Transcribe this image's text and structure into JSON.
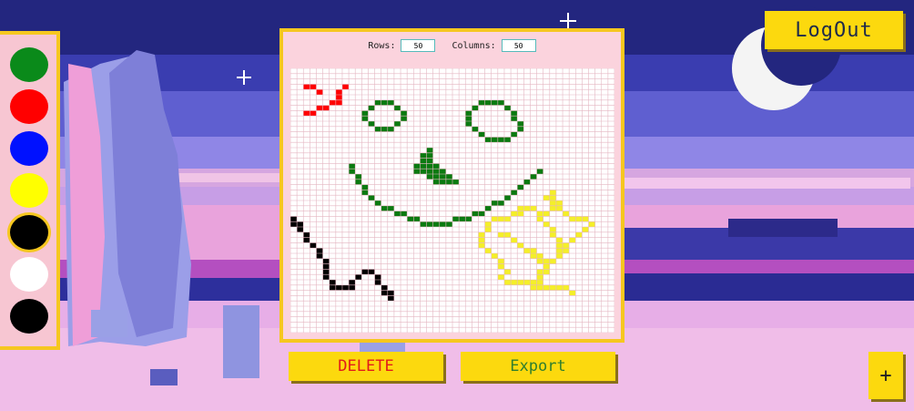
{
  "colors": {
    "palette": [
      "#0a8a1a",
      "#ff0000",
      "#0011ff",
      "#ffff00",
      "#000000",
      "#ffffff",
      "#000000"
    ],
    "accent": "#fcd90e",
    "board_bg": "#fbd3dd",
    "grid_line": "#e4b6c2"
  },
  "selected_color_index": 4,
  "grid": {
    "rows_label": "Rows:",
    "rows_value": "50",
    "columns_label": "Columns:",
    "columns_value": "50",
    "rows": 50,
    "columns": 50
  },
  "drawing": {
    "red": [
      [
        3,
        2
      ],
      [
        3,
        3
      ],
      [
        4,
        4
      ],
      [
        3,
        8
      ],
      [
        4,
        7
      ],
      [
        5,
        7
      ],
      [
        6,
        7
      ],
      [
        6,
        6
      ],
      [
        7,
        5
      ],
      [
        7,
        4
      ],
      [
        8,
        3
      ],
      [
        8,
        2
      ]
    ],
    "green_left_eye": [
      [
        6,
        13
      ],
      [
        6,
        14
      ],
      [
        6,
        15
      ],
      [
        7,
        12
      ],
      [
        7,
        16
      ],
      [
        8,
        11
      ],
      [
        8,
        17
      ],
      [
        9,
        11
      ],
      [
        9,
        17
      ],
      [
        10,
        12
      ],
      [
        10,
        16
      ],
      [
        11,
        13
      ],
      [
        11,
        14
      ],
      [
        11,
        15
      ]
    ],
    "green_right_eye": [
      [
        6,
        29
      ],
      [
        6,
        30
      ],
      [
        6,
        31
      ],
      [
        6,
        32
      ],
      [
        7,
        28
      ],
      [
        7,
        33
      ],
      [
        8,
        27
      ],
      [
        8,
        34
      ],
      [
        9,
        27
      ],
      [
        9,
        34
      ],
      [
        10,
        27
      ],
      [
        10,
        35
      ],
      [
        11,
        28
      ],
      [
        11,
        35
      ],
      [
        12,
        29
      ],
      [
        12,
        34
      ],
      [
        13,
        30
      ],
      [
        13,
        31
      ],
      [
        13,
        32
      ],
      [
        13,
        33
      ]
    ],
    "green_nose": [
      [
        15,
        21
      ],
      [
        16,
        20
      ],
      [
        16,
        21
      ],
      [
        17,
        20
      ],
      [
        17,
        21
      ],
      [
        18,
        19
      ],
      [
        18,
        20
      ],
      [
        18,
        21
      ],
      [
        18,
        22
      ],
      [
        19,
        19
      ],
      [
        19,
        20
      ],
      [
        19,
        21
      ],
      [
        19,
        22
      ],
      [
        19,
        23
      ],
      [
        20,
        21
      ],
      [
        20,
        22
      ],
      [
        20,
        23
      ],
      [
        20,
        24
      ],
      [
        21,
        22
      ],
      [
        21,
        23
      ],
      [
        21,
        24
      ],
      [
        21,
        25
      ]
    ],
    "green_smile": [
      [
        18,
        9
      ],
      [
        19,
        9
      ],
      [
        20,
        10
      ],
      [
        21,
        10
      ],
      [
        22,
        11
      ],
      [
        23,
        11
      ],
      [
        24,
        12
      ],
      [
        25,
        13
      ],
      [
        26,
        14
      ],
      [
        26,
        15
      ],
      [
        27,
        16
      ],
      [
        27,
        17
      ],
      [
        28,
        18
      ],
      [
        28,
        19
      ],
      [
        29,
        20
      ],
      [
        29,
        21
      ],
      [
        29,
        22
      ],
      [
        29,
        23
      ],
      [
        29,
        24
      ],
      [
        28,
        25
      ],
      [
        28,
        26
      ],
      [
        28,
        27
      ],
      [
        27,
        28
      ],
      [
        27,
        29
      ],
      [
        26,
        30
      ],
      [
        25,
        31
      ],
      [
        25,
        32
      ],
      [
        24,
        33
      ],
      [
        23,
        34
      ],
      [
        22,
        35
      ],
      [
        21,
        36
      ],
      [
        20,
        37
      ],
      [
        19,
        38
      ]
    ],
    "yellow_star": [
      [
        23,
        40
      ],
      [
        24,
        39
      ],
      [
        24,
        40
      ],
      [
        25,
        40
      ],
      [
        25,
        41
      ],
      [
        26,
        40
      ],
      [
        26,
        41
      ],
      [
        27,
        39
      ],
      [
        27,
        42
      ],
      [
        26,
        35
      ],
      [
        26,
        36
      ],
      [
        26,
        37
      ],
      [
        27,
        34
      ],
      [
        27,
        38
      ],
      [
        28,
        31
      ],
      [
        28,
        32
      ],
      [
        28,
        33
      ],
      [
        28,
        38
      ],
      [
        28,
        43
      ],
      [
        28,
        44
      ],
      [
        28,
        45
      ],
      [
        29,
        30
      ],
      [
        29,
        39
      ],
      [
        29,
        46
      ],
      [
        30,
        30
      ],
      [
        30,
        45
      ],
      [
        31,
        29
      ],
      [
        31,
        32
      ],
      [
        31,
        33
      ],
      [
        31,
        44
      ],
      [
        32,
        29
      ],
      [
        32,
        34
      ],
      [
        32,
        43
      ],
      [
        33,
        29
      ],
      [
        33,
        35
      ],
      [
        33,
        42
      ],
      [
        34,
        30
      ],
      [
        34,
        36
      ],
      [
        34,
        42
      ],
      [
        35,
        31
      ],
      [
        35,
        41
      ],
      [
        36,
        32
      ],
      [
        36,
        40
      ],
      [
        37,
        32
      ],
      [
        37,
        39
      ],
      [
        38,
        33
      ],
      [
        38,
        38
      ],
      [
        38,
        39
      ],
      [
        39,
        32
      ],
      [
        39,
        38
      ],
      [
        40,
        33
      ],
      [
        40,
        34
      ],
      [
        40,
        35
      ],
      [
        40,
        36
      ],
      [
        40,
        37
      ],
      [
        40,
        38
      ],
      [
        41,
        37
      ],
      [
        41,
        38
      ],
      [
        41,
        39
      ],
      [
        41,
        40
      ],
      [
        41,
        41
      ],
      [
        41,
        42
      ],
      [
        42,
        43
      ],
      [
        34,
        37
      ],
      [
        35,
        37
      ],
      [
        35,
        38
      ],
      [
        36,
        38
      ],
      [
        36,
        39
      ],
      [
        30,
        40
      ],
      [
        31,
        40
      ],
      [
        32,
        41
      ],
      [
        33,
        41
      ],
      [
        34,
        41
      ],
      [
        27,
        35
      ]
    ],
    "black": [
      [
        28,
        0
      ],
      [
        29,
        0
      ],
      [
        29,
        1
      ],
      [
        30,
        1
      ],
      [
        31,
        2
      ],
      [
        32,
        2
      ],
      [
        33,
        3
      ],
      [
        34,
        4
      ],
      [
        35,
        4
      ],
      [
        36,
        5
      ],
      [
        37,
        5
      ],
      [
        38,
        5
      ],
      [
        39,
        5
      ],
      [
        40,
        6
      ],
      [
        41,
        6
      ],
      [
        41,
        7
      ],
      [
        41,
        8
      ],
      [
        41,
        9
      ],
      [
        40,
        9
      ],
      [
        39,
        10
      ],
      [
        38,
        11
      ],
      [
        38,
        12
      ],
      [
        39,
        13
      ],
      [
        40,
        13
      ],
      [
        41,
        14
      ],
      [
        42,
        14
      ],
      [
        42,
        15
      ],
      [
        43,
        15
      ]
    ]
  },
  "buttons": {
    "logout": "LogOut",
    "delete": "DELETE",
    "export": "Export",
    "add": "+"
  }
}
